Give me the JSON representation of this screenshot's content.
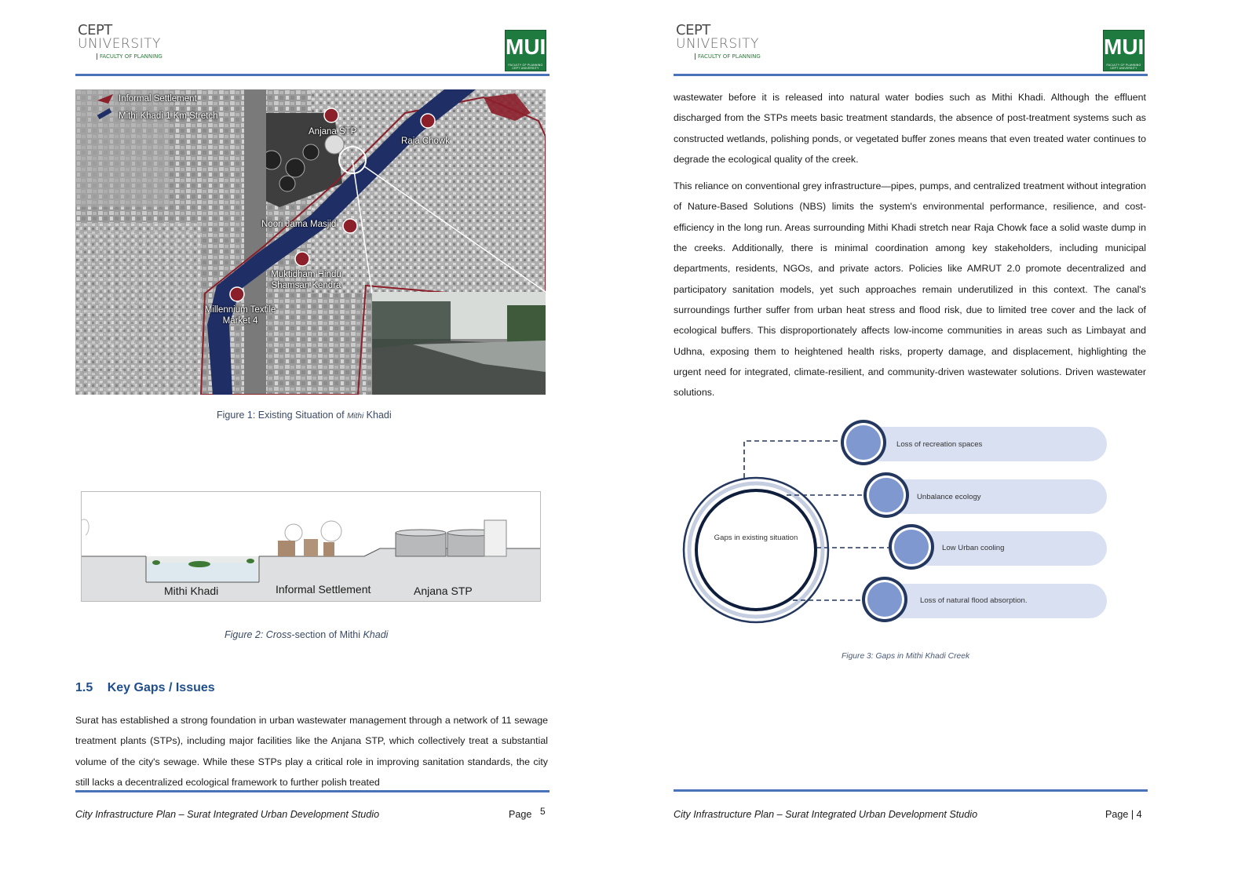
{
  "header": {
    "cept_line1": "CEPT",
    "cept_line2": "UNIVERSITY",
    "cept_faculty": "FACULTY OF PLANNING",
    "mui_text": "MUI",
    "mui_sub": "FACULTY OF PLANNING CEPT UNIVERSITY"
  },
  "left_page": {
    "map": {
      "legend": [
        "Informal Settlement",
        "Mithi Khadi 1 Km Stretch"
      ],
      "places": [
        "Anjana STP",
        "Raja Chowk",
        "Noori Jama Masjid",
        "Muktidham Hindu Shamsan Kendra",
        "Millennium Textile Market 4"
      ]
    },
    "figure1_caption_a": "Figure 1: Existing Situation of ",
    "figure1_caption_b": "Mithi",
    "figure1_caption_c": " Khadi",
    "section": {
      "labels": [
        "Mithi Khadi",
        "Informal Settlement",
        "Anjana STP"
      ]
    },
    "figure2_caption_a": "Figure 2: Cross",
    "figure2_caption_b": "-section of Mithi ",
    "figure2_caption_c": "Khadi",
    "heading_num": "1.5",
    "heading_text": "Key Gaps / Issues",
    "paragraph": "Surat has established a strong foundation in urban wastewater management through a network of 11 sewage treatment plants (STPs), including major facilities like the Anjana STP, which collectively treat a substantial volume of the city's sewage. While these STPs play a critical role in improving sanitation standards, the city still lacks a decentralized ecological framework to further polish treated",
    "footer": "City Infrastructure Plan – Surat Integrated Urban Development Studio",
    "page_label": "Page",
    "page_number": "5"
  },
  "right_page": {
    "paragraph1": "wastewater before it is released into natural water bodies such as Mithi Khadi. Although the effluent discharged from the STPs meets basic treatment standards, the absence of post-treatment systems such as constructed wetlands, polishing ponds, or vegetated buffer zones means that even treated water continues to degrade the ecological quality of the creek.",
    "paragraph2": "This reliance on conventional grey infrastructure—pipes, pumps, and centralized treatment without integration of Nature-Based Solutions (NBS) limits the system's environmental performance, resilience, and cost-efficiency in the long run. Areas surrounding Mithi Khadi stretch near Raja Chowk face a solid waste dump in the creeks. Additionally, there is minimal coordination among key stakeholders, including municipal departments, residents, NGOs, and private actors. Policies like AMRUT 2.0 promote decentralized and participatory sanitation models, yet such approaches remain underutilized in this context. The canal's surroundings further suffer from urban heat stress and flood risk, due to limited tree cover and the lack of ecological buffers. This disproportionately affects low-income communities in areas such as Limbayat and Udhna, exposing them to heightened health risks, property damage, and displacement, highlighting the urgent need for integrated, climate-resilient, and community-driven wastewater solutions. Driven wastewater solutions.",
    "diagram": {
      "center": "Gaps in existing situation",
      "gaps": [
        "Loss of recreation spaces",
        "Unbalance ecology",
        "Low Urban cooling",
        "Loss of natural flood absorption."
      ]
    },
    "figure3_caption": "Figure 3: Gaps in Mithi Khadi Creek",
    "footer": "City Infrastructure Plan – Surat Integrated Urban Development Studio",
    "page_label": "Page | 4"
  }
}
